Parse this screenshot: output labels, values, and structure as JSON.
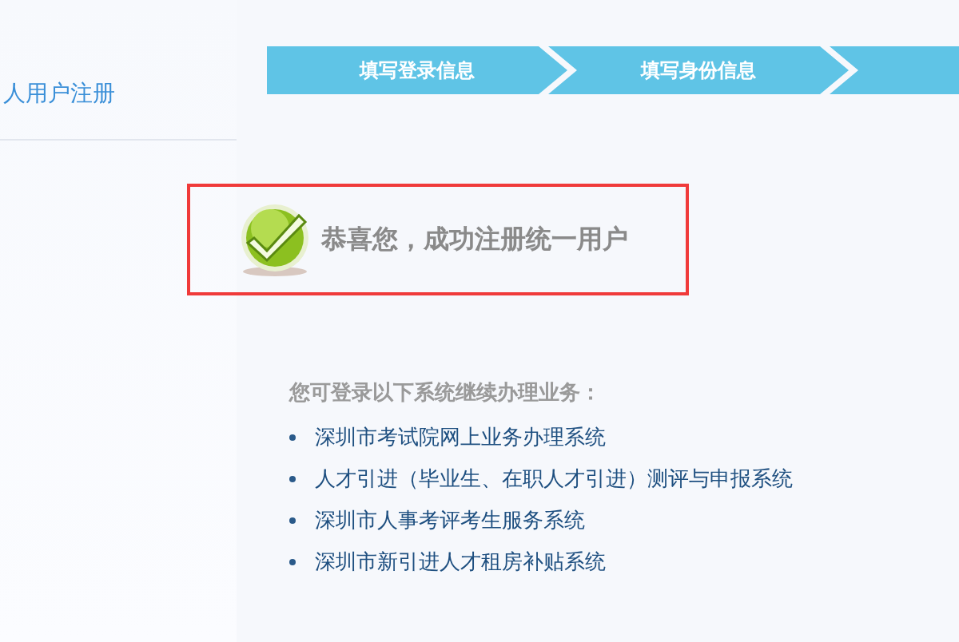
{
  "sidebar": {
    "title": "人用户注册"
  },
  "steps": [
    {
      "label": "填写登录信息"
    },
    {
      "label": "填写身份信息"
    }
  ],
  "result": {
    "message": "恭喜您，成功注册统一用户"
  },
  "systems": {
    "heading": "您可登录以下系统继续办理业务：",
    "items": [
      "深圳市考试院网上业务办理系统",
      "人才引进（毕业生、在职人才引进）测评与申报系统",
      "深圳市人事考评考生服务系统",
      "深圳市新引进人才租房补贴系统"
    ]
  }
}
